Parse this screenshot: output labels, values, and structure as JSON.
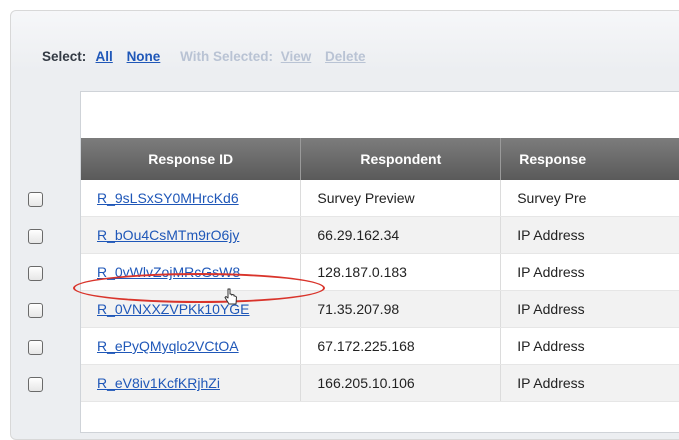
{
  "select_bar": {
    "label": "Select:",
    "all": "All",
    "none": "None",
    "with_selected": "With Selected:",
    "view": "View",
    "delete": "Delete"
  },
  "table": {
    "columns": [
      "Response ID",
      "Respondent",
      "Response"
    ],
    "rows": [
      {
        "id": "R_9sLSxSY0MHrcKd6",
        "respondent": "Survey Preview",
        "response": "Survey Pre"
      },
      {
        "id": "R_bOu4CsMTm9rO6jy",
        "respondent": "66.29.162.34",
        "response": "IP Address"
      },
      {
        "id": "R_0vWlvZojMRcGsW8",
        "respondent": "128.187.0.183",
        "response": "IP Address"
      },
      {
        "id": "R_0VNXXZVPKk10YGE",
        "respondent": "71.35.207.98",
        "response": "IP Address"
      },
      {
        "id": "R_ePyQMyqlo2VCtOA",
        "respondent": "67.172.225.168",
        "response": "IP Address"
      },
      {
        "id": "R_eV8iv1KcfKRjhZi",
        "respondent": "166.205.10.106",
        "response": "IP Address"
      }
    ]
  },
  "highlight": {
    "color": "#d9342b"
  },
  "colors": {
    "link": "#1f57b8",
    "header_bg": "#6b6b6b"
  }
}
